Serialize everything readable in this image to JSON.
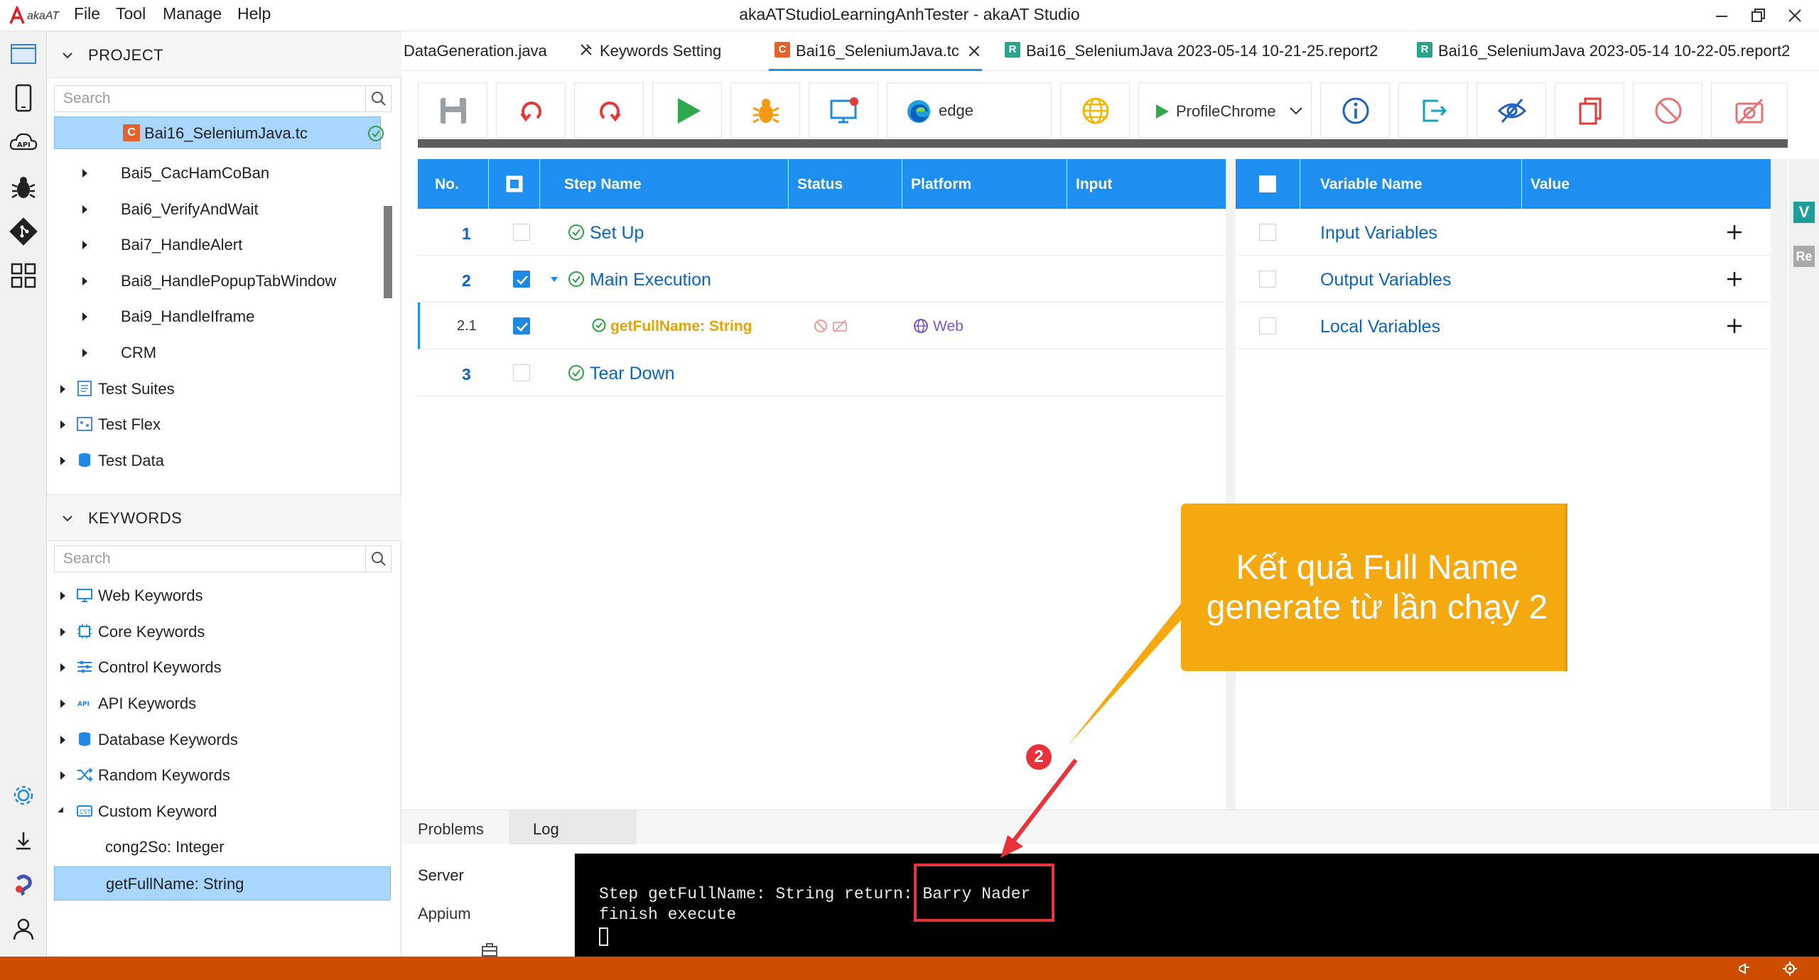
{
  "titlebar": {
    "logo": "akaAT",
    "menus": [
      "File",
      "Tool",
      "Manage",
      "Help"
    ],
    "title": "akaATStudioLearningAnhTester - akaAT Studio"
  },
  "activity": {
    "icons": [
      "explorer-icon",
      "mobile-icon",
      "api-icon",
      "bug-icon",
      "git-icon",
      "extensions-icon"
    ],
    "bottom_icons": [
      "settings-icon",
      "download-icon",
      "plugin-icon",
      "account-icon"
    ]
  },
  "project": {
    "header": "PROJECT",
    "search_placeholder": "Search",
    "items": [
      {
        "label": "Bai16_SeleniumJava.tc",
        "selected": true
      },
      {
        "label": "Bai5_CacHamCoBan"
      },
      {
        "label": "Bai6_VerifyAndWait"
      },
      {
        "label": "Bai7_HandleAlert"
      },
      {
        "label": "Bai8_HandlePopupTabWindow"
      },
      {
        "label": "Bai9_HandleIframe"
      },
      {
        "label": "CRM"
      },
      {
        "label": "Test Suites"
      },
      {
        "label": "Test Flex"
      },
      {
        "label": "Test Data"
      }
    ]
  },
  "keywords": {
    "header": "KEYWORDS",
    "search_placeholder": "Search",
    "items": [
      {
        "label": "Web Keywords"
      },
      {
        "label": "Core Keywords"
      },
      {
        "label": "Control Keywords"
      },
      {
        "label": "API Keywords"
      },
      {
        "label": "Database Keywords"
      },
      {
        "label": "Random Keywords"
      },
      {
        "label": "Custom Keyword"
      },
      {
        "label": "cong2So: Integer"
      },
      {
        "label": "getFullName: String",
        "selected": true
      }
    ]
  },
  "tabs": [
    {
      "label": "DataGeneration.java"
    },
    {
      "label": "Keywords Setting"
    },
    {
      "label": "Bai16_SeleniumJava.tc",
      "active": true,
      "badge": "C"
    },
    {
      "label": "Bai16_SeleniumJava 2023-05-14 10-21-25.report2",
      "badge": "R"
    },
    {
      "label": "Bai16_SeleniumJava 2023-05-14 10-22-05.report2",
      "badge": "R"
    }
  ],
  "toolbar": {
    "browser": "edge",
    "profile": "ProfileChrome"
  },
  "steps": {
    "columns": [
      "No.",
      "Step Name",
      "Status",
      "Platform",
      "Input"
    ],
    "rows": [
      {
        "no": "1",
        "name": "Set Up",
        "checked": false
      },
      {
        "no": "2",
        "name": "Main Execution",
        "checked": true
      },
      {
        "no": "2.1",
        "name": "getFullName: String",
        "checked": true,
        "platform": "Web"
      },
      {
        "no": "3",
        "name": "Tear Down",
        "checked": false
      }
    ]
  },
  "variables": {
    "columns": [
      "Variable Name",
      "Value"
    ],
    "rows": [
      {
        "name": "Input Variables"
      },
      {
        "name": "Output Variables"
      },
      {
        "name": "Local Variables"
      }
    ],
    "side_tabs": [
      "V",
      "Re"
    ]
  },
  "bottom": {
    "tabs": [
      "Problems",
      "Log"
    ],
    "left_items": [
      "Server",
      "Appium"
    ],
    "console_lines": [
      "Step getFullName: String return: Barry Nader",
      "finish execute"
    ],
    "highlight": "Barry Nader"
  },
  "annotation": {
    "text_line1": "Kết quả Full Name",
    "text_line2": "generate từ lần chạy 2",
    "badge": "2"
  },
  "colors": {
    "accent": "#1e8ff0",
    "callout": "#f5a70b",
    "statusbar": "#ce4c00",
    "highlight": "#e8333a"
  }
}
